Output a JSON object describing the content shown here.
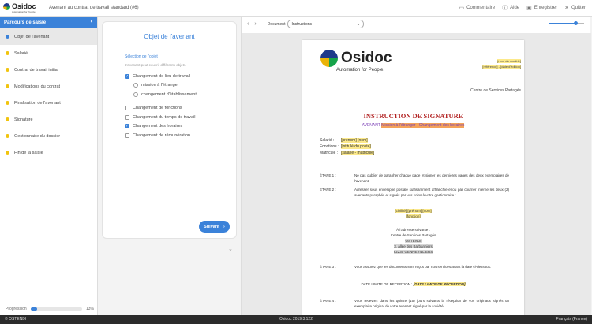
{
  "header": {
    "logo_text": "Osidoc",
    "logo_tagline": "Automation for People",
    "doc_title": "Avenant au contrat de travail standard (#6)",
    "actions": [
      {
        "label": "Commentaire",
        "icon": "comment-icon"
      },
      {
        "label": "Aide",
        "icon": "help-icon"
      },
      {
        "label": "Enregistrer",
        "icon": "save-icon"
      },
      {
        "label": "Quitter",
        "icon": "exit-icon"
      }
    ]
  },
  "sidebar": {
    "title": "Parcours de saisie",
    "items": [
      {
        "label": "Objet de l'avenant",
        "status": "active"
      },
      {
        "label": "Salarié",
        "status": "pending"
      },
      {
        "label": "Contrat de travail initial",
        "status": "pending"
      },
      {
        "label": "Modifications du contrat",
        "status": "pending"
      },
      {
        "label": "Finalisation de l'avenant",
        "status": "pending"
      },
      {
        "label": "Signature",
        "status": "pending"
      },
      {
        "label": "Gestionnaire du dossier",
        "status": "pending"
      },
      {
        "label": "Fin de la saisie",
        "status": "pending"
      }
    ],
    "progress_label": "Progression",
    "progress_value": 0.13,
    "progress_text": "13%"
  },
  "form": {
    "title": "Objet de l'avenant",
    "section_label": "Sélection de l'objet",
    "hint": "L'avenant peut couvrir différents objets.",
    "options": [
      {
        "label": "Changement de lieu de travail",
        "type": "checkbox",
        "checked": true,
        "indent": 0
      },
      {
        "label": "mission à l'étranger",
        "type": "radio",
        "checked": false,
        "indent": 1
      },
      {
        "label": "changement d'établissement",
        "type": "radio",
        "checked": false,
        "indent": 1
      },
      {
        "label": "Changement de fonctions",
        "type": "checkbox",
        "checked": false,
        "indent": 0
      },
      {
        "label": "Changement du temps de travail",
        "type": "checkbox",
        "checked": false,
        "indent": 0
      },
      {
        "label": "Changement des horaires",
        "type": "checkbox",
        "checked": true,
        "indent": 0
      },
      {
        "label": "Changement de rémunération",
        "type": "checkbox",
        "checked": false,
        "indent": 0
      }
    ],
    "next_label": "Suivant"
  },
  "viewer": {
    "document_label": "Document",
    "document_value": "Instructions",
    "zoom_value": 0.75
  },
  "page": {
    "brand_name": "Osidoc",
    "brand_tagline": "Automation for People.",
    "field_modele": "[nom du modèle]",
    "field_reference": "[référence] - [date d'édition]",
    "service": "Centre de Services Partagés",
    "title": "INSTRUCTION DE SIGNATURE",
    "sub_prefix": "AVENANT",
    "sub_value": "Mission à l'étranger - Changement des horaires",
    "fields": [
      {
        "label": "Salarié :",
        "value": "[prénom] [nom]"
      },
      {
        "label": "Fonctions :",
        "value": "[intitulé du poste]"
      },
      {
        "label": "Matricule :",
        "value": "[salarié - matricule]"
      }
    ],
    "step1_num": "ÉTAPE 1 :",
    "step1_text": "Ne pas oublier de parapher chaque page et signer les dernières pages des deux exemplaires de l'avenant.",
    "step2_num": "ÉTAPE 2 :",
    "step2_text": "Adresser sous enveloppe postale suffisamment affranchie et/ou par courrier interne les deux (2) avenants paraphés et signés par vos soins à votre gestionnaire :",
    "gest_name": "[civilité] [prénom] [nom]",
    "gest_function": "[fonction]",
    "address_intro": "À l'adresse suivante :",
    "address_lines": [
      "Centre de Services Partagés",
      "OSTENDI",
      "3, allée des Barbanniers",
      "92230 GENNEVILLIERS"
    ],
    "step3_num": "ÉTAPE 3 :",
    "step3_text": "Vous assurez que les documents sont reçus par nos services avant la date ci-dessous.",
    "deadline_label": "DATE LIMITE DE RECEPTION :",
    "deadline_value": "[DATE LIMITE DE RÉCEPTION]",
    "step4_num": "ÉTAPE 4 :",
    "step4_text": "Vous recevrez dans les quinze (15) jours suivants la réception de vos originaux signés un exemplaire original de votre avenant signé par la société."
  },
  "footer": {
    "company": "© OSTENDI",
    "version": "Osidoc 2019.3.122",
    "language": "Français (France)"
  }
}
